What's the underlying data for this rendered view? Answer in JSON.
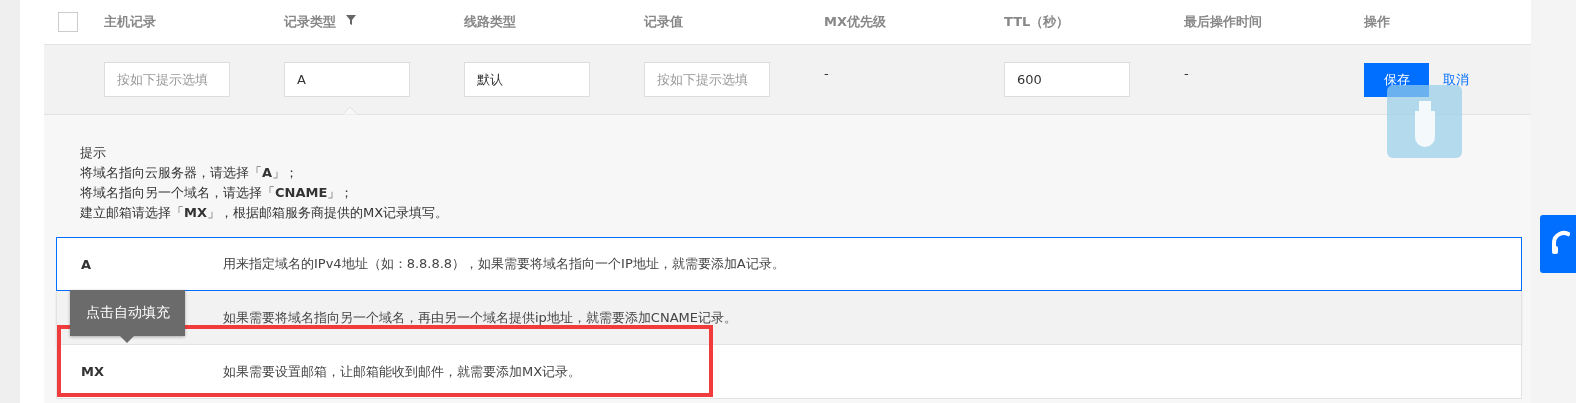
{
  "table": {
    "select_all": {
      "checked": false
    },
    "columns": [
      {
        "label": "主机记录",
        "filter": false
      },
      {
        "label": "记录类型",
        "filter": true
      },
      {
        "label": "线路类型",
        "filter": false
      },
      {
        "label": "记录值",
        "filter": false
      },
      {
        "label": "MX优先级",
        "filter": false
      },
      {
        "label": "TTL（秒）",
        "filter": false
      },
      {
        "label": "最后操作时间",
        "filter": false
      },
      {
        "label": "操作",
        "filter": false
      }
    ],
    "edit_row": {
      "host": {
        "placeholder": "按如下提示选填"
      },
      "type": {
        "value": "A"
      },
      "line": {
        "value": "默认"
      },
      "record_value": {
        "placeholder": "按如下提示选填"
      },
      "mx_priority": "-",
      "ttl": {
        "value": "600"
      },
      "last_time": "-",
      "save": "保存",
      "cancel": "取消"
    }
  },
  "hint": {
    "title": "提示",
    "lines": [
      "将域名指向云服务器，请选择「**A**」；",
      "将域名指向另一个域名，请选择「**CNAME**」；",
      "建立邮箱请选择「**MX**」，根据邮箱服务商提供的MX记录填写。"
    ]
  },
  "options": [
    {
      "label": "A",
      "description": "用来指定域名的IPv4地址（如：8.8.8.8），如果需要将域名指向一个IP地址，就需要添加A记录。",
      "selected": true,
      "hovered": false,
      "outlined": false
    },
    {
      "description": "如果需要将域名指向另一个域名，再由另一个域名提供ip地址，就需要添加CNAME记录。",
      "selected": false,
      "hovered": true,
      "outlined": false
    },
    {
      "label": "MX",
      "description": "如果需要设置邮箱，让邮箱能收到邮件，就需要添加MX记录。",
      "selected": false,
      "hovered": false,
      "outlined": true
    }
  ],
  "tooltip": "点击自动填充"
}
